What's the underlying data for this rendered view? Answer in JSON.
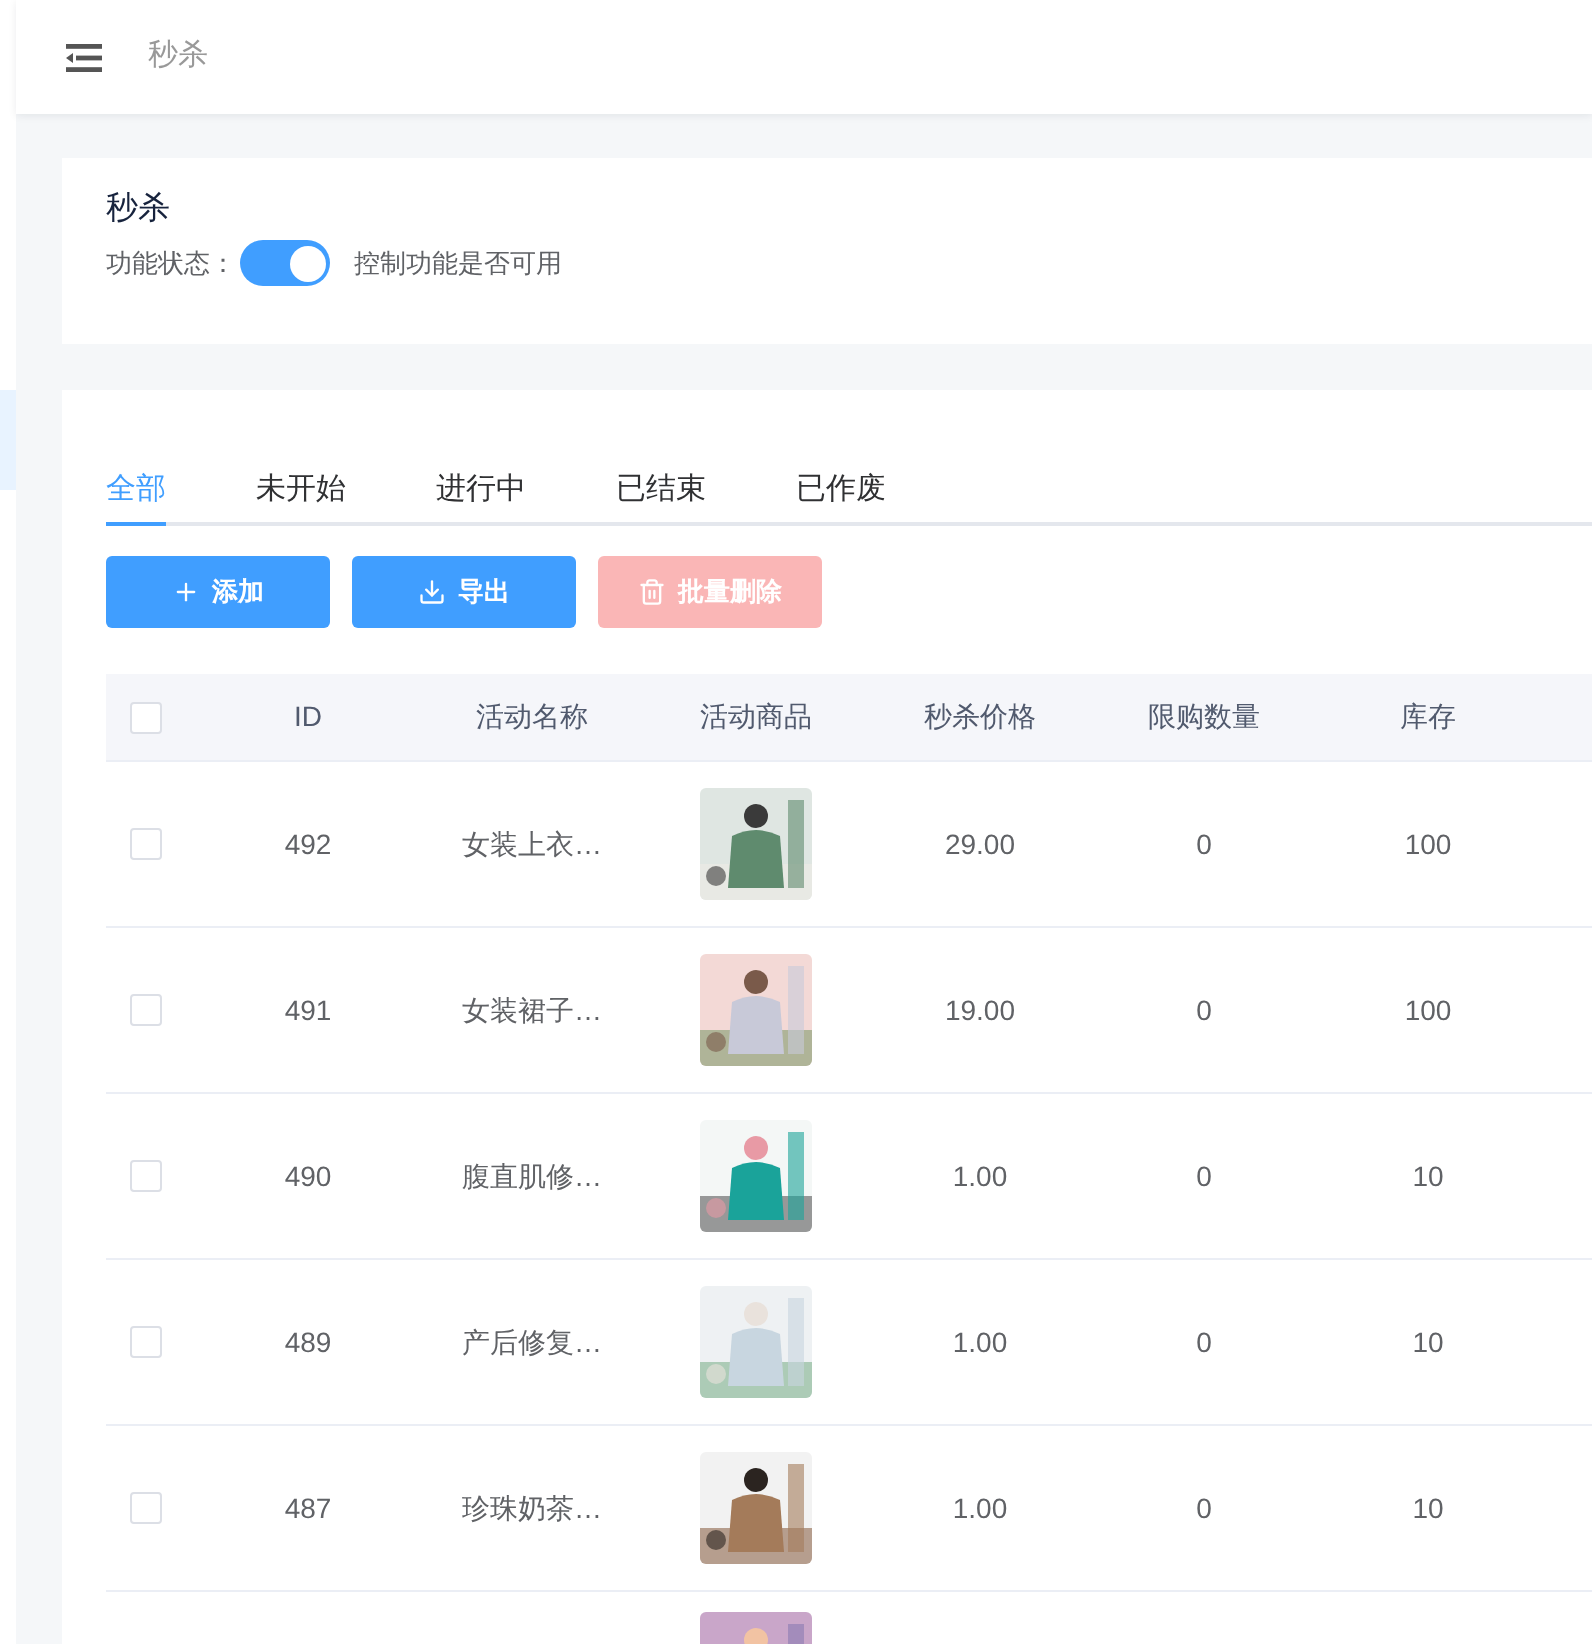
{
  "header": {
    "title": "秒杀"
  },
  "feature_card": {
    "title": "秒杀",
    "status_label": "功能状态：",
    "switch": {
      "on": true
    },
    "hint": "控制功能是否可用"
  },
  "tabs": [
    {
      "label": "全部",
      "selected": true
    },
    {
      "label": "未开始",
      "selected": false
    },
    {
      "label": "进行中",
      "selected": false
    },
    {
      "label": "已结束",
      "selected": false
    },
    {
      "label": "已作废",
      "selected": false
    }
  ],
  "actions": [
    {
      "label": "添加",
      "kind": "add",
      "disabled": false
    },
    {
      "label": "导出",
      "kind": "export",
      "disabled": false
    },
    {
      "label": "批量删除",
      "kind": "delete",
      "disabled": true
    }
  ],
  "table": {
    "select_all": {
      "checked": false
    },
    "columns": [
      "ID",
      "活动名称",
      "活动商品",
      "秒杀价格",
      "限购数量",
      "库存"
    ],
    "rows": [
      {
        "checked": false,
        "id": "492",
        "name": "女装上衣…",
        "price": "29.00",
        "limit": "0",
        "stock": "100"
      },
      {
        "checked": false,
        "id": "491",
        "name": "女装裙子…",
        "price": "19.00",
        "limit": "0",
        "stock": "100"
      },
      {
        "checked": false,
        "id": "490",
        "name": "腹直肌修…",
        "price": "1.00",
        "limit": "0",
        "stock": "10"
      },
      {
        "checked": false,
        "id": "489",
        "name": "产后修复…",
        "price": "1.00",
        "limit": "0",
        "stock": "10"
      },
      {
        "checked": false,
        "id": "487",
        "name": "珍珠奶茶…",
        "price": "1.00",
        "limit": "0",
        "stock": "10"
      }
    ]
  }
}
